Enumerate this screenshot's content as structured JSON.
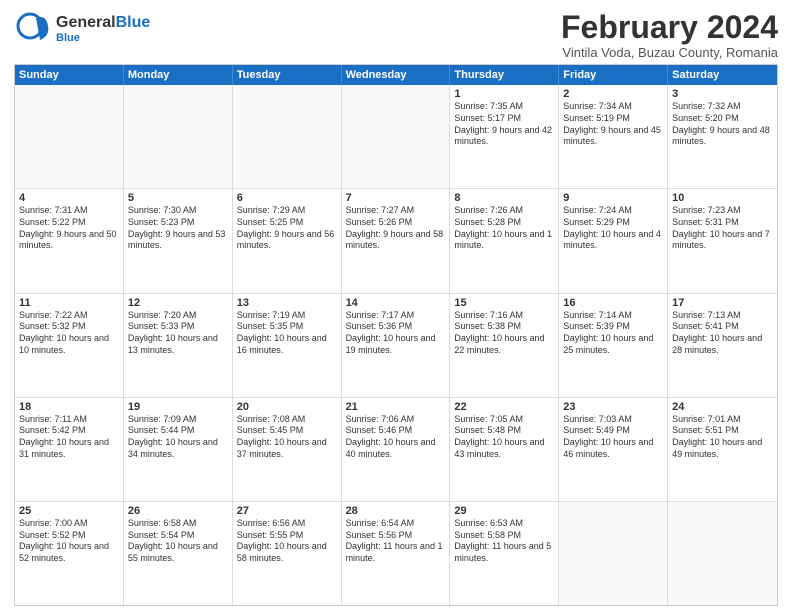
{
  "header": {
    "logo_general": "General",
    "logo_blue": "Blue",
    "month_title": "February 2024",
    "location": "Vintila Voda, Buzau County, Romania"
  },
  "days_of_week": [
    "Sunday",
    "Monday",
    "Tuesday",
    "Wednesday",
    "Thursday",
    "Friday",
    "Saturday"
  ],
  "weeks": [
    [
      {
        "day": "",
        "sunrise": "",
        "sunset": "",
        "daylight": "",
        "empty": true
      },
      {
        "day": "",
        "sunrise": "",
        "sunset": "",
        "daylight": "",
        "empty": true
      },
      {
        "day": "",
        "sunrise": "",
        "sunset": "",
        "daylight": "",
        "empty": true
      },
      {
        "day": "",
        "sunrise": "",
        "sunset": "",
        "daylight": "",
        "empty": true
      },
      {
        "day": "1",
        "sunrise": "Sunrise: 7:35 AM",
        "sunset": "Sunset: 5:17 PM",
        "daylight": "Daylight: 9 hours and 42 minutes.",
        "empty": false
      },
      {
        "day": "2",
        "sunrise": "Sunrise: 7:34 AM",
        "sunset": "Sunset: 5:19 PM",
        "daylight": "Daylight: 9 hours and 45 minutes.",
        "empty": false
      },
      {
        "day": "3",
        "sunrise": "Sunrise: 7:32 AM",
        "sunset": "Sunset: 5:20 PM",
        "daylight": "Daylight: 9 hours and 48 minutes.",
        "empty": false
      }
    ],
    [
      {
        "day": "4",
        "sunrise": "Sunrise: 7:31 AM",
        "sunset": "Sunset: 5:22 PM",
        "daylight": "Daylight: 9 hours and 50 minutes.",
        "empty": false
      },
      {
        "day": "5",
        "sunrise": "Sunrise: 7:30 AM",
        "sunset": "Sunset: 5:23 PM",
        "daylight": "Daylight: 9 hours and 53 minutes.",
        "empty": false
      },
      {
        "day": "6",
        "sunrise": "Sunrise: 7:29 AM",
        "sunset": "Sunset: 5:25 PM",
        "daylight": "Daylight: 9 hours and 56 minutes.",
        "empty": false
      },
      {
        "day": "7",
        "sunrise": "Sunrise: 7:27 AM",
        "sunset": "Sunset: 5:26 PM",
        "daylight": "Daylight: 9 hours and 58 minutes.",
        "empty": false
      },
      {
        "day": "8",
        "sunrise": "Sunrise: 7:26 AM",
        "sunset": "Sunset: 5:28 PM",
        "daylight": "Daylight: 10 hours and 1 minute.",
        "empty": false
      },
      {
        "day": "9",
        "sunrise": "Sunrise: 7:24 AM",
        "sunset": "Sunset: 5:29 PM",
        "daylight": "Daylight: 10 hours and 4 minutes.",
        "empty": false
      },
      {
        "day": "10",
        "sunrise": "Sunrise: 7:23 AM",
        "sunset": "Sunset: 5:31 PM",
        "daylight": "Daylight: 10 hours and 7 minutes.",
        "empty": false
      }
    ],
    [
      {
        "day": "11",
        "sunrise": "Sunrise: 7:22 AM",
        "sunset": "Sunset: 5:32 PM",
        "daylight": "Daylight: 10 hours and 10 minutes.",
        "empty": false
      },
      {
        "day": "12",
        "sunrise": "Sunrise: 7:20 AM",
        "sunset": "Sunset: 5:33 PM",
        "daylight": "Daylight: 10 hours and 13 minutes.",
        "empty": false
      },
      {
        "day": "13",
        "sunrise": "Sunrise: 7:19 AM",
        "sunset": "Sunset: 5:35 PM",
        "daylight": "Daylight: 10 hours and 16 minutes.",
        "empty": false
      },
      {
        "day": "14",
        "sunrise": "Sunrise: 7:17 AM",
        "sunset": "Sunset: 5:36 PM",
        "daylight": "Daylight: 10 hours and 19 minutes.",
        "empty": false
      },
      {
        "day": "15",
        "sunrise": "Sunrise: 7:16 AM",
        "sunset": "Sunset: 5:38 PM",
        "daylight": "Daylight: 10 hours and 22 minutes.",
        "empty": false
      },
      {
        "day": "16",
        "sunrise": "Sunrise: 7:14 AM",
        "sunset": "Sunset: 5:39 PM",
        "daylight": "Daylight: 10 hours and 25 minutes.",
        "empty": false
      },
      {
        "day": "17",
        "sunrise": "Sunrise: 7:13 AM",
        "sunset": "Sunset: 5:41 PM",
        "daylight": "Daylight: 10 hours and 28 minutes.",
        "empty": false
      }
    ],
    [
      {
        "day": "18",
        "sunrise": "Sunrise: 7:11 AM",
        "sunset": "Sunset: 5:42 PM",
        "daylight": "Daylight: 10 hours and 31 minutes.",
        "empty": false
      },
      {
        "day": "19",
        "sunrise": "Sunrise: 7:09 AM",
        "sunset": "Sunset: 5:44 PM",
        "daylight": "Daylight: 10 hours and 34 minutes.",
        "empty": false
      },
      {
        "day": "20",
        "sunrise": "Sunrise: 7:08 AM",
        "sunset": "Sunset: 5:45 PM",
        "daylight": "Daylight: 10 hours and 37 minutes.",
        "empty": false
      },
      {
        "day": "21",
        "sunrise": "Sunrise: 7:06 AM",
        "sunset": "Sunset: 5:46 PM",
        "daylight": "Daylight: 10 hours and 40 minutes.",
        "empty": false
      },
      {
        "day": "22",
        "sunrise": "Sunrise: 7:05 AM",
        "sunset": "Sunset: 5:48 PM",
        "daylight": "Daylight: 10 hours and 43 minutes.",
        "empty": false
      },
      {
        "day": "23",
        "sunrise": "Sunrise: 7:03 AM",
        "sunset": "Sunset: 5:49 PM",
        "daylight": "Daylight: 10 hours and 46 minutes.",
        "empty": false
      },
      {
        "day": "24",
        "sunrise": "Sunrise: 7:01 AM",
        "sunset": "Sunset: 5:51 PM",
        "daylight": "Daylight: 10 hours and 49 minutes.",
        "empty": false
      }
    ],
    [
      {
        "day": "25",
        "sunrise": "Sunrise: 7:00 AM",
        "sunset": "Sunset: 5:52 PM",
        "daylight": "Daylight: 10 hours and 52 minutes.",
        "empty": false
      },
      {
        "day": "26",
        "sunrise": "Sunrise: 6:58 AM",
        "sunset": "Sunset: 5:54 PM",
        "daylight": "Daylight: 10 hours and 55 minutes.",
        "empty": false
      },
      {
        "day": "27",
        "sunrise": "Sunrise: 6:56 AM",
        "sunset": "Sunset: 5:55 PM",
        "daylight": "Daylight: 10 hours and 58 minutes.",
        "empty": false
      },
      {
        "day": "28",
        "sunrise": "Sunrise: 6:54 AM",
        "sunset": "Sunset: 5:56 PM",
        "daylight": "Daylight: 11 hours and 1 minute.",
        "empty": false
      },
      {
        "day": "29",
        "sunrise": "Sunrise: 6:53 AM",
        "sunset": "Sunset: 5:58 PM",
        "daylight": "Daylight: 11 hours and 5 minutes.",
        "empty": false
      },
      {
        "day": "",
        "sunrise": "",
        "sunset": "",
        "daylight": "",
        "empty": true
      },
      {
        "day": "",
        "sunrise": "",
        "sunset": "",
        "daylight": "",
        "empty": true
      }
    ]
  ]
}
